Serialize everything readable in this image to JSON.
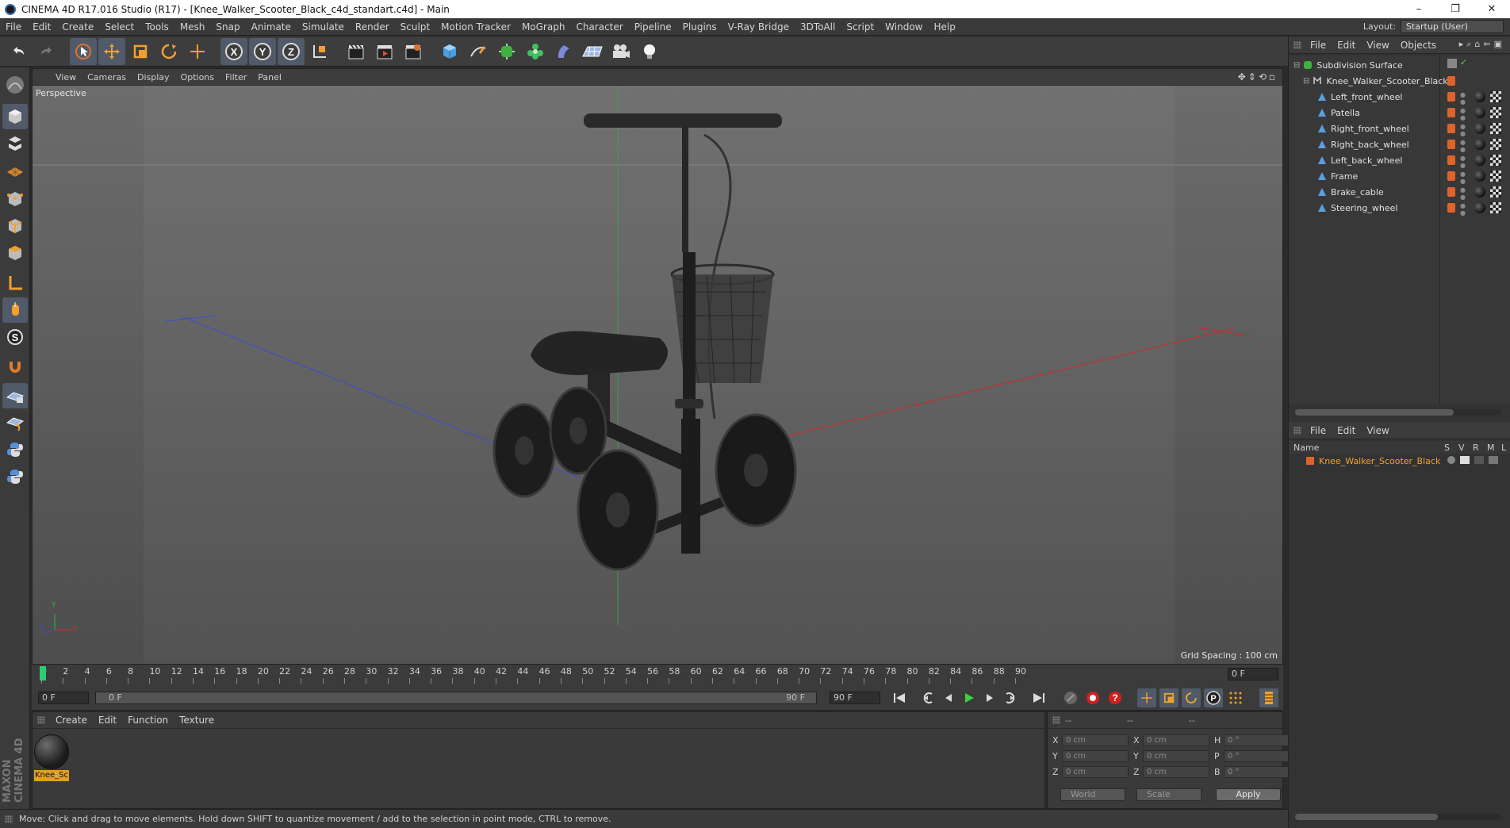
{
  "window": {
    "title": "CINEMA 4D R17.016 Studio (R17) - [Knee_Walker_Scooter_Black_c4d_standart.c4d] - Main",
    "minimize": "–",
    "restore": "❐",
    "close": "✕"
  },
  "menubar": {
    "items": [
      "File",
      "Edit",
      "Create",
      "Select",
      "Tools",
      "Mesh",
      "Snap",
      "Animate",
      "Simulate",
      "Render",
      "Sculpt",
      "Motion Tracker",
      "MoGraph",
      "Character",
      "Pipeline",
      "Plugins",
      "V-Ray Bridge",
      "3DToAll",
      "Script",
      "Window",
      "Help"
    ],
    "layout_label": "Layout:",
    "layout_value": "Startup (User)"
  },
  "viewport": {
    "menu": [
      "View",
      "Cameras",
      "Display",
      "Options",
      "Filter",
      "Panel"
    ],
    "label": "Perspective",
    "grid_spacing": "Grid Spacing : 100 cm",
    "axis_x": "X",
    "axis_y": "Y",
    "axis_z": "Z"
  },
  "timeline": {
    "ticks": [
      "0",
      "2",
      "4",
      "6",
      "8",
      "10",
      "12",
      "14",
      "16",
      "18",
      "20",
      "22",
      "24",
      "26",
      "28",
      "30",
      "32",
      "34",
      "36",
      "38",
      "40",
      "42",
      "44",
      "46",
      "48",
      "50",
      "52",
      "54",
      "56",
      "58",
      "60",
      "62",
      "64",
      "66",
      "68",
      "70",
      "72",
      "74",
      "76",
      "78",
      "80",
      "82",
      "84",
      "86",
      "88",
      "90"
    ],
    "current_frame": "0 F",
    "start_field": "0 F",
    "range_start": "0 F",
    "range_end": "90 F",
    "end_field": "90 F"
  },
  "materials": {
    "menu": [
      "Create",
      "Edit",
      "Function",
      "Texture"
    ],
    "items": [
      {
        "label": "Knee_Sc"
      }
    ]
  },
  "attributes": {
    "header": [
      "--",
      "--",
      "--"
    ],
    "rows": [
      {
        "a": "X",
        "av": "0 cm",
        "b": "X",
        "bv": "0 cm",
        "c": "H",
        "cv": "0 °"
      },
      {
        "a": "Y",
        "av": "0 cm",
        "b": "Y",
        "bv": "0 cm",
        "c": "P",
        "cv": "0 °"
      },
      {
        "a": "Z",
        "av": "0 cm",
        "b": "Z",
        "bv": "0 cm",
        "c": "B",
        "cv": "0 °"
      }
    ],
    "coord_mode": "World",
    "size_mode": "Scale",
    "apply": "Apply"
  },
  "status": "Move: Click and drag to move elements. Hold down SHIFT to quantize movement / add to the selection in point mode, CTRL to remove.",
  "maxon": "MAXON CINEMA 4D",
  "object_manager": {
    "menu": [
      "File",
      "Edit",
      "View",
      "Objects"
    ],
    "root": "Subdivision Surface",
    "group": "Knee_Walker_Scooter_Black",
    "children": [
      "Left_front_wheel",
      "Patella",
      "Right_front_wheel",
      "Right_back_wheel",
      "Left_back_wheel",
      "Frame",
      "Brake_cable",
      "Steering_wheel"
    ]
  },
  "layer_manager": {
    "menu": [
      "File",
      "Edit",
      "View"
    ],
    "columns": [
      "Name",
      "S",
      "V",
      "R",
      "M",
      "L"
    ],
    "rows": [
      "Knee_Walker_Scooter_Black"
    ]
  },
  "colors": {
    "accent_blue": "#505a69",
    "tag_orange": "#e0642a",
    "layer_text": "#f0a030",
    "timeline_cursor": "#2ecc71"
  }
}
